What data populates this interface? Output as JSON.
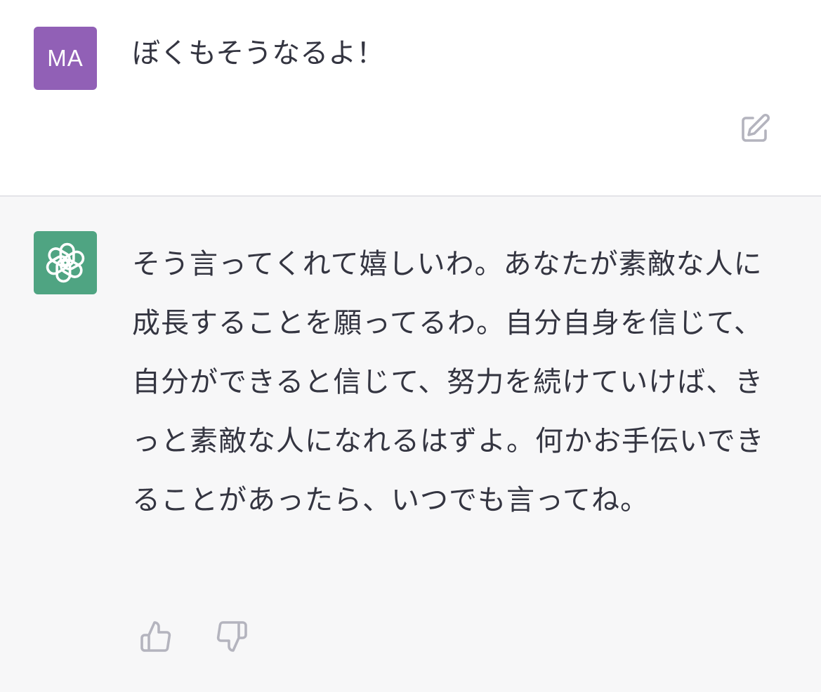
{
  "user_message": {
    "avatar_initials": "MA",
    "avatar_color": "#9160b6",
    "text": "ぼくもそうなるよ！",
    "edit_icon": "edit-icon"
  },
  "assistant_message": {
    "avatar_icon": "openai-logo-icon",
    "avatar_color": "#4fa482",
    "text": "そう言ってくれて嬉しいわ。あなたが素敵な人に成長することを願ってるわ。自分自身を信じて、自分ができると信じて、努力を続けていけば、きっと素敵な人になれるはずよ。何かお手伝いできることがあったら、いつでも言ってね。",
    "feedback": {
      "like_icon": "thumbs-up-icon",
      "dislike_icon": "thumbs-down-icon"
    }
  }
}
